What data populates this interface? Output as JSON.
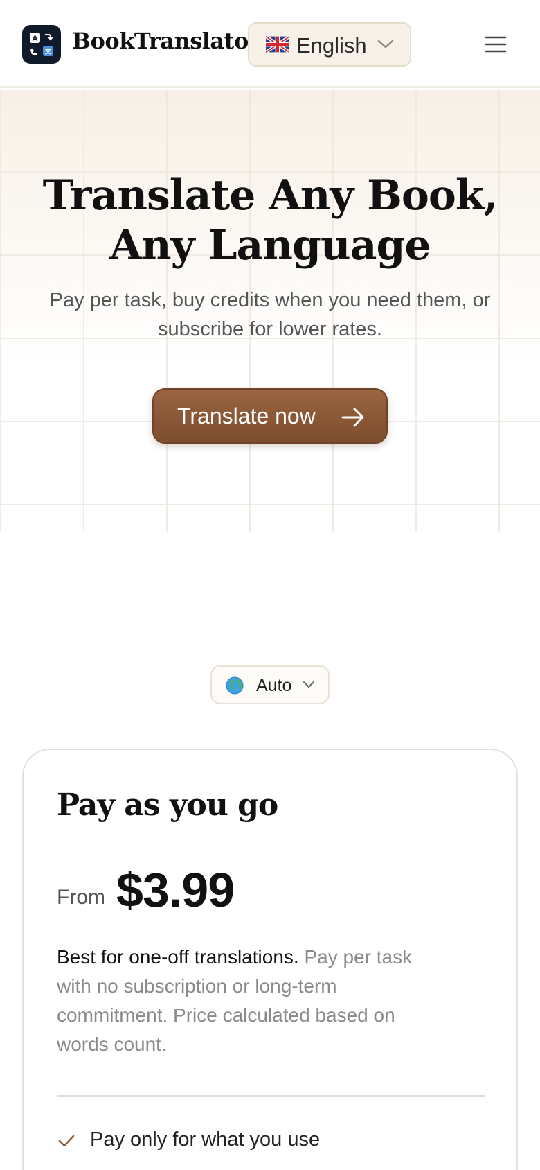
{
  "header": {
    "brand": "BookTranslator",
    "language": {
      "flag": "uk-flag",
      "label": "English"
    },
    "menu_icon": "hamburger-menu-icon"
  },
  "hero": {
    "title_line1": "Translate Any Book,",
    "title_line2": "Any Language",
    "subtitle": "Pay per task, buy credits when you need them, or subscribe for lower rates.",
    "cta_label": "Translate now",
    "cta_icon": "arrow-right-icon"
  },
  "pricing": {
    "region_select": {
      "icon": "globe-icon",
      "label": "Auto"
    },
    "plan": {
      "title": "Pay as you go",
      "price_prefix": "From",
      "price": "$3.99",
      "desc_strong": "Best for one-off translations.",
      "desc_rest": " Pay per task with no subscription or long-term commitment. Price calculated based on words count.",
      "features": [
        "Pay only for what you use"
      ]
    }
  },
  "colors": {
    "accent": "#8b5a36",
    "logo_bg": "#0f1b2a",
    "select_bg": "#f7f1e8",
    "check": "#8b5a36"
  }
}
